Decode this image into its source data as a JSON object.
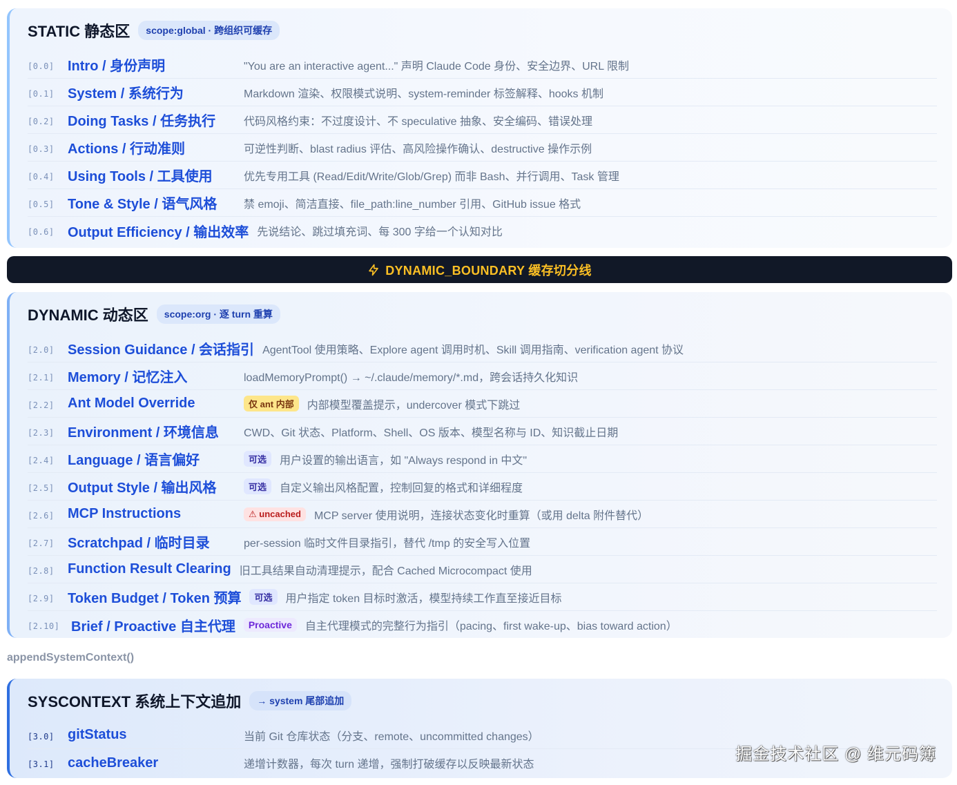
{
  "static": {
    "title": "STATIC 静态区",
    "scope": "scope:global · 跨组织可缓存",
    "rows": [
      {
        "code": "[0.0]",
        "name": "Intro / 身份声明",
        "desc": "\"You are an interactive agent...\" 声明 Claude Code 身份、安全边界、URL 限制"
      },
      {
        "code": "[0.1]",
        "name": "System / 系统行为",
        "desc": "Markdown 渲染、权限模式说明、system-reminder 标签解释、hooks 机制"
      },
      {
        "code": "[0.2]",
        "name": "Doing Tasks / 任务执行",
        "desc": "代码风格约束：不过度设计、不 speculative 抽象、安全编码、错误处理"
      },
      {
        "code": "[0.3]",
        "name": "Actions / 行动准则",
        "desc": "可逆性判断、blast radius 评估、高风险操作确认、destructive 操作示例"
      },
      {
        "code": "[0.4]",
        "name": "Using Tools / 工具使用",
        "desc": "优先专用工具 (Read/Edit/Write/Glob/Grep) 而非 Bash、并行调用、Task 管理"
      },
      {
        "code": "[0.5]",
        "name": "Tone & Style / 语气风格",
        "desc": "禁 emoji、简洁直接、file_path:line_number 引用、GitHub issue 格式"
      },
      {
        "code": "[0.6]",
        "name": "Output Efficiency / 输出效率",
        "desc": "先说结论、跳过填充词、每 300 字给一个认知对比"
      }
    ]
  },
  "boundary": {
    "label": "DYNAMIC_BOUNDARY 缓存切分线"
  },
  "dynamic": {
    "title": "DYNAMIC 动态区",
    "scope": "scope:org · 逐 turn 重算",
    "rows": [
      {
        "code": "[2.0]",
        "name": "Session Guidance / 会话指引",
        "tag": "",
        "desc": "AgentTool 使用策略、Explore agent 调用时机、Skill 调用指南、verification agent 协议"
      },
      {
        "code": "[2.1]",
        "name": "Memory / 记忆注入",
        "tag": "",
        "desc": "loadMemoryPrompt() → ~/.claude/memory/*.md，跨会话持久化知识"
      },
      {
        "code": "[2.2]",
        "name": "Ant Model Override",
        "tag": "仅 ant 内部",
        "desc": "内部模型覆盖提示，undercover 模式下跳过"
      },
      {
        "code": "[2.3]",
        "name": "Environment / 环境信息",
        "tag": "",
        "desc": "CWD、Git 状态、Platform、Shell、OS 版本、模型名称与 ID、知识截止日期"
      },
      {
        "code": "[2.4]",
        "name": "Language / 语言偏好",
        "tag": "可选",
        "desc": "用户设置的输出语言，如 \"Always respond in 中文\""
      },
      {
        "code": "[2.5]",
        "name": "Output Style / 输出风格",
        "tag": "可选",
        "desc": "自定义输出风格配置，控制回复的格式和详细程度"
      },
      {
        "code": "[2.6]",
        "name": "MCP Instructions",
        "tag": "⚠ uncached",
        "desc": "MCP server 使用说明，连接状态变化时重算（或用 delta 附件替代）"
      },
      {
        "code": "[2.7]",
        "name": "Scratchpad / 临时目录",
        "tag": "",
        "desc": "per-session 临时文件目录指引，替代 /tmp 的安全写入位置"
      },
      {
        "code": "[2.8]",
        "name": "Function Result Clearing",
        "tag": "",
        "desc": "旧工具结果自动清理提示，配合 Cached Microcompact 使用"
      },
      {
        "code": "[2.9]",
        "name": "Token Budget / Token 预算",
        "tag": "可选",
        "desc": "用户指定 token 目标时激活，模型持续工作直至接近目标"
      },
      {
        "code": "[2.10]",
        "name": "Brief / Proactive 自主代理",
        "tag": "Proactive",
        "desc": "自主代理模式的完整行为指引（pacing、first wake-up、bias toward action）"
      }
    ]
  },
  "append_label": "appendSystemContext()",
  "syscontext": {
    "title": "SYSCONTEXT 系统上下文追加",
    "scope": "→ system 尾部追加",
    "rows": [
      {
        "code": "[3.0]",
        "name": "gitStatus",
        "desc": "当前 Git 仓库状态（分支、remote、uncommitted changes）"
      },
      {
        "code": "[3.1]",
        "name": "cacheBreaker",
        "desc": "递增计数器，每次 turn 递增，强制打破缓存以反映最新状态"
      }
    ]
  },
  "watermark": "掘金技术社区 @ 维元码簿"
}
